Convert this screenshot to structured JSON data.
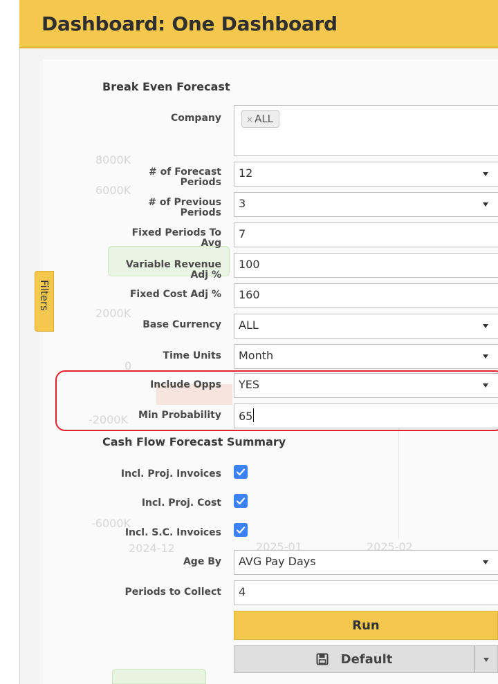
{
  "header": {
    "title": "Dashboard: One Dashboard"
  },
  "filters_tab": {
    "label": "Filters"
  },
  "break_even": {
    "heading": "Break Even Forecast",
    "company": {
      "label": "Company",
      "chip": "ALL",
      "chip_remove": "×"
    },
    "forecast_periods": {
      "label_line1": "# of Forecast",
      "label_line2": "Periods",
      "value": "12"
    },
    "previous_periods": {
      "label_line1": "# of Previous",
      "label_line2": "Periods",
      "value": "3"
    },
    "fixed_periods_avg": {
      "label_line1": "Fixed Periods To",
      "label_line2": "Avg",
      "value": "7"
    },
    "variable_revenue_adj": {
      "label_line1": "Variable Revenue",
      "label_line2": "Adj %",
      "value": "100"
    },
    "fixed_cost_adj": {
      "label": "Fixed Cost Adj %",
      "value": "160"
    },
    "base_currency": {
      "label": "Base Currency",
      "value": "ALL"
    },
    "time_units": {
      "label": "Time Units",
      "value": "Month"
    },
    "include_opps": {
      "label": "Include Opps",
      "value": "YES"
    },
    "min_probability": {
      "label": "Min Probability",
      "value": "65"
    }
  },
  "cash_flow": {
    "heading": "Cash Flow Forecast Summary",
    "incl_proj_invoices": {
      "label": "Incl. Proj. Invoices",
      "checked": true
    },
    "incl_proj_cost": {
      "label": "Incl. Proj. Cost",
      "checked": true
    },
    "incl_sc_invoices": {
      "label": "Incl. S.C. Invoices",
      "checked": true
    },
    "age_by": {
      "label": "Age By",
      "value": "AVG Pay Days"
    },
    "periods_to_collect": {
      "label": "Periods to Collect",
      "value": "4"
    }
  },
  "buttons": {
    "run": "Run",
    "default": "Default"
  },
  "background_chart": {
    "y_ticks": [
      "8000K",
      "6000K",
      "2000K",
      "0",
      "-2000K",
      "-6000K"
    ],
    "x_ticks": [
      "2024-12",
      "2025-01",
      "2025-02"
    ]
  },
  "colors": {
    "accent": "#f3c84d",
    "checkbox": "#3b82f6",
    "highlight": "#e0202a"
  }
}
